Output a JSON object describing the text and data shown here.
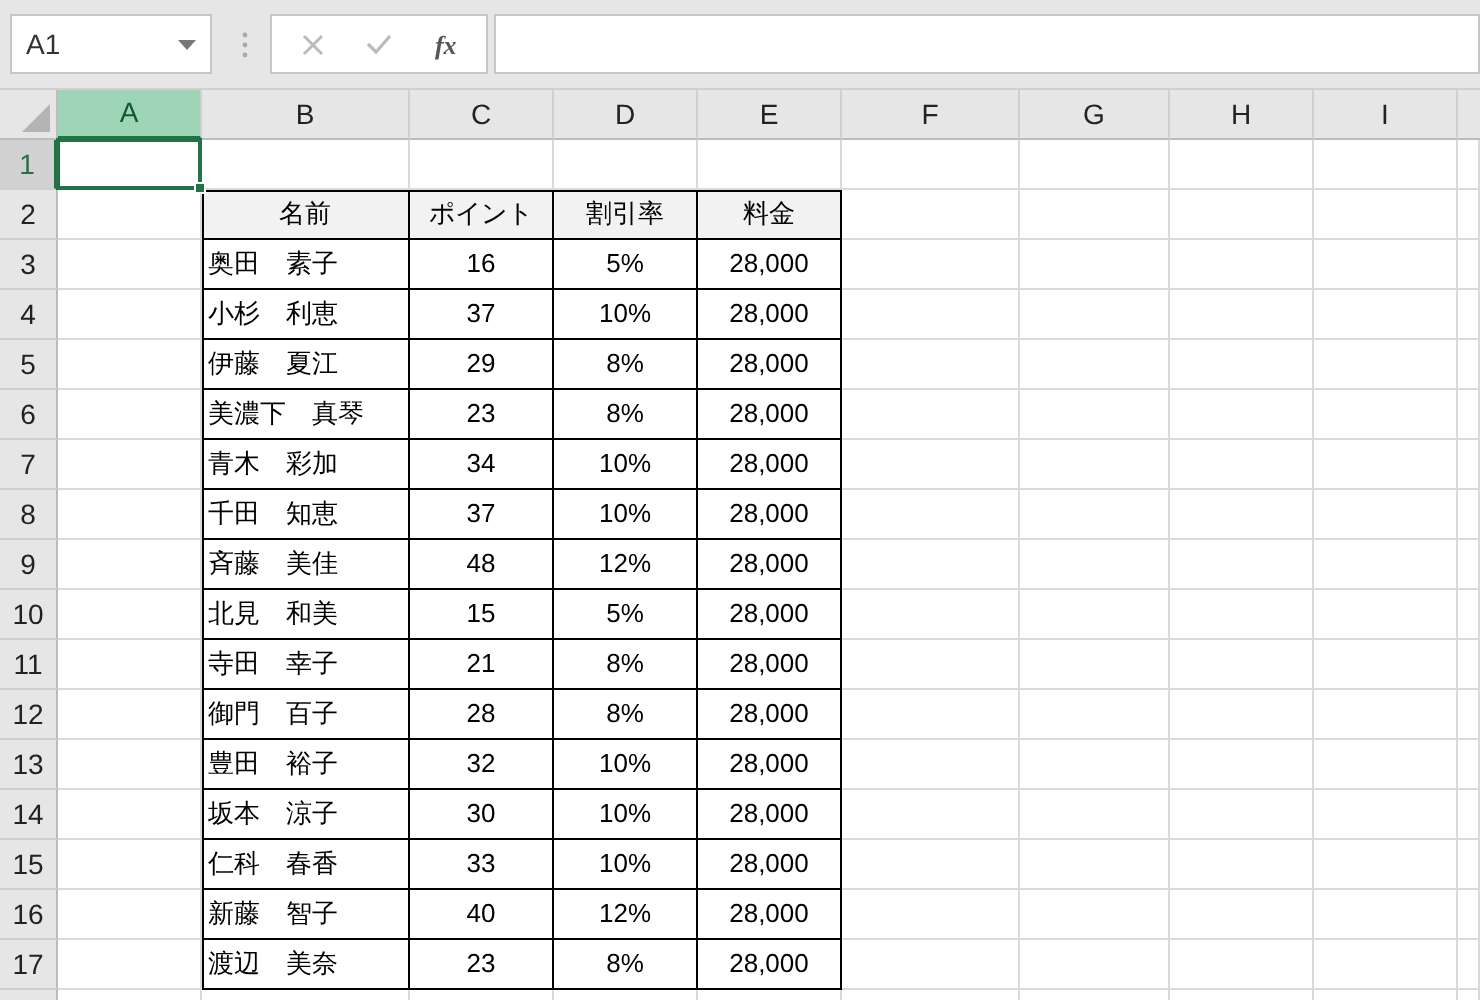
{
  "name_box": {
    "value": "A1"
  },
  "formula_bar": {
    "function_label": "fx"
  },
  "columns": [
    {
      "label": "A",
      "selected": true
    },
    {
      "label": "B",
      "selected": false
    },
    {
      "label": "C",
      "selected": false
    },
    {
      "label": "D",
      "selected": false
    },
    {
      "label": "E",
      "selected": false
    },
    {
      "label": "F",
      "selected": false
    },
    {
      "label": "G",
      "selected": false
    },
    {
      "label": "H",
      "selected": false
    },
    {
      "label": "I",
      "selected": false
    }
  ],
  "rows": [
    {
      "label": "1",
      "selected": true
    },
    {
      "label": "2",
      "selected": false
    },
    {
      "label": "3",
      "selected": false
    },
    {
      "label": "4",
      "selected": false
    },
    {
      "label": "5",
      "selected": false
    },
    {
      "label": "6",
      "selected": false
    },
    {
      "label": "7",
      "selected": false
    },
    {
      "label": "8",
      "selected": false
    },
    {
      "label": "9",
      "selected": false
    },
    {
      "label": "10",
      "selected": false
    },
    {
      "label": "11",
      "selected": false
    },
    {
      "label": "12",
      "selected": false
    },
    {
      "label": "13",
      "selected": false
    },
    {
      "label": "14",
      "selected": false
    },
    {
      "label": "15",
      "selected": false
    },
    {
      "label": "16",
      "selected": false
    },
    {
      "label": "17",
      "selected": false
    }
  ],
  "table": {
    "columns": [
      "名前",
      "ポイント",
      "割引率",
      "料金"
    ],
    "rows": [
      [
        "奥田　素子",
        "16",
        "5%",
        "28,000"
      ],
      [
        "小杉　利恵",
        "37",
        "10%",
        "28,000"
      ],
      [
        "伊藤　夏江",
        "29",
        "8%",
        "28,000"
      ],
      [
        "美濃下　真琴",
        "23",
        "8%",
        "28,000"
      ],
      [
        "青木　彩加",
        "34",
        "10%",
        "28,000"
      ],
      [
        "千田　知恵",
        "37",
        "10%",
        "28,000"
      ],
      [
        "斉藤　美佳",
        "48",
        "12%",
        "28,000"
      ],
      [
        "北見　和美",
        "15",
        "5%",
        "28,000"
      ],
      [
        "寺田　幸子",
        "21",
        "8%",
        "28,000"
      ],
      [
        "御門　百子",
        "28",
        "8%",
        "28,000"
      ],
      [
        "豊田　裕子",
        "32",
        "10%",
        "28,000"
      ],
      [
        "坂本　涼子",
        "30",
        "10%",
        "28,000"
      ],
      [
        "仁科　春香",
        "33",
        "10%",
        "28,000"
      ],
      [
        "新藤　智子",
        "40",
        "12%",
        "28,000"
      ],
      [
        "渡辺　美奈",
        "23",
        "8%",
        "28,000"
      ]
    ]
  }
}
